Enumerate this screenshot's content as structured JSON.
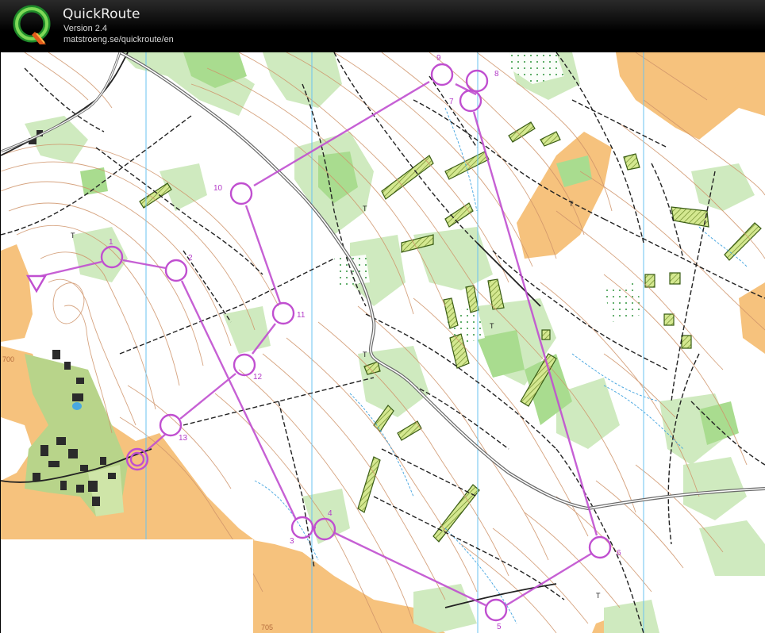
{
  "app": {
    "title": "QuickRoute",
    "version": "Version 2.4",
    "url": "matstroeng.se/quickroute/en",
    "logo_letter": "Q"
  },
  "colors": {
    "course": "#c04fd0",
    "open_land": "#f6c27d",
    "forest_light": "#c9e8b8",
    "forest_green": "#a8db8f",
    "contour": "#c98a5a",
    "path": "#222222",
    "water_line": "#4aa8e0",
    "magnetic_north": "#6ec6f0"
  },
  "map": {
    "contour_labels": [
      "700",
      "705"
    ],
    "symbol_T": "T",
    "course": {
      "start_symbol": "triangle",
      "finish_symbol": "double-circle",
      "controls": [
        {
          "label": "1"
        },
        {
          "label": "2"
        },
        {
          "label": "3"
        },
        {
          "label": "4"
        },
        {
          "label": "5"
        },
        {
          "label": "6"
        },
        {
          "label": "7"
        },
        {
          "label": "8"
        },
        {
          "label": "9"
        },
        {
          "label": "10"
        },
        {
          "label": "11"
        },
        {
          "label": "12"
        },
        {
          "label": "13"
        }
      ]
    }
  }
}
